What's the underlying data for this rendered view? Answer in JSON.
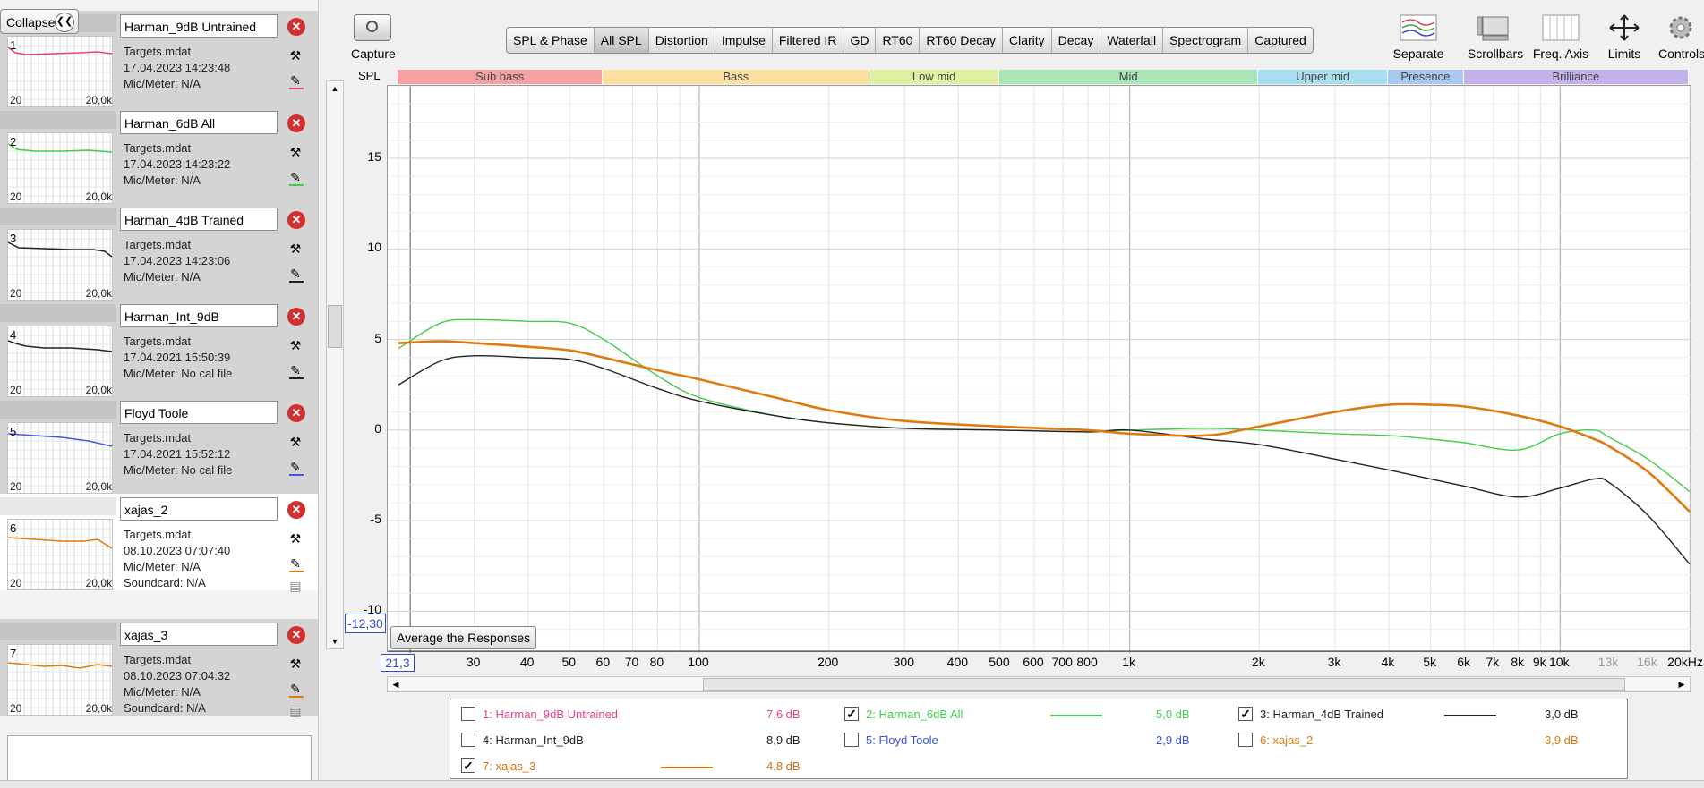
{
  "left_panel": {
    "collapse_label": "Collapse",
    "collapse_icon": "double-chevron-left-icon",
    "measurements": [
      {
        "num": "1",
        "name": "Harman_9dB Untrained",
        "file": "Targets.mdat",
        "date": "17.04.2023 14:23:48",
        "mic": "Mic/Meter: N/A",
        "soundcard": "",
        "color": "#e8418c",
        "axis_left": "20",
        "axis_right": "20,0k",
        "selected": false
      },
      {
        "num": "2",
        "name": "Harman_6dB All",
        "file": "Targets.mdat",
        "date": "17.04.2023 14:23:22",
        "mic": "Mic/Meter: N/A",
        "soundcard": "",
        "color": "#3fcf4a",
        "axis_left": "20",
        "axis_right": "20,0k",
        "selected": false
      },
      {
        "num": "3",
        "name": "Harman_4dB Trained",
        "file": "Targets.mdat",
        "date": "17.04.2023 14:23:06",
        "mic": "Mic/Meter: N/A",
        "soundcard": "",
        "color": "#222222",
        "axis_left": "20",
        "axis_right": "20,0k",
        "selected": false
      },
      {
        "num": "4",
        "name": "Harman_Int_9dB",
        "file": "Targets.mdat",
        "date": "17.04.2021 15:50:39",
        "mic": "Mic/Meter: No cal file",
        "soundcard": "",
        "color": "#222222",
        "axis_left": "20",
        "axis_right": "20,0k",
        "selected": false
      },
      {
        "num": "5",
        "name": "Floyd Toole",
        "file": "Targets.mdat",
        "date": "17.04.2021 15:52:12",
        "mic": "Mic/Meter: No cal file",
        "soundcard": "",
        "color": "#4455e0",
        "axis_left": "20",
        "axis_right": "20,0k",
        "selected": false
      },
      {
        "num": "6",
        "name": "xajas_2",
        "file": "Targets.mdat",
        "date": "08.10.2023 07:07:40",
        "mic": "Mic/Meter: N/A",
        "soundcard": "Soundcard: N/A",
        "color": "#e07a10",
        "axis_left": "20",
        "axis_right": "20,0k",
        "selected": true
      },
      {
        "num": "7",
        "name": "xajas_3",
        "file": "Targets.mdat",
        "date": "08.10.2023 07:04:32",
        "mic": "Mic/Meter: N/A",
        "soundcard": "Soundcard: N/A",
        "color": "#e07a10",
        "axis_left": "20",
        "axis_right": "20,0k",
        "selected": false
      }
    ]
  },
  "toolbar": {
    "capture_label": "Capture",
    "tabs": [
      "SPL & Phase",
      "All SPL",
      "Distortion",
      "Impulse",
      "Filtered IR",
      "GD",
      "RT60",
      "RT60 Decay",
      "Clarity",
      "Decay",
      "Waterfall",
      "Spectrogram",
      "Captured"
    ],
    "active_tab": "All SPL",
    "right_tools": [
      {
        "label": "Separate",
        "icon": "separate-traces-icon"
      },
      {
        "label": "Scrollbars",
        "icon": "scrollbars-icon"
      },
      {
        "label": "Freq. Axis",
        "icon": "freq-axis-icon"
      },
      {
        "label": "Limits",
        "icon": "limits-arrows-icon"
      },
      {
        "label": "Controls",
        "icon": "gear-icon"
      }
    ]
  },
  "plot": {
    "y_unit_label": "SPL",
    "y_cursor_value": "-12,30",
    "x_cursor_value": "21,3",
    "average_button": "Average the Responses",
    "bands": [
      {
        "label": "Sub bass",
        "color": "#f6a0a4"
      },
      {
        "label": "Bass",
        "color": "#fbe0a0"
      },
      {
        "label": "Low mid",
        "color": "#dff0a0"
      },
      {
        "label": "Mid",
        "color": "#a8e6b8"
      },
      {
        "label": "Upper mid",
        "color": "#a8dff0"
      },
      {
        "label": "Presence",
        "color": "#a8c8f4"
      },
      {
        "label": "Brilliance",
        "color": "#c4b0ec"
      }
    ]
  },
  "chart_data": {
    "type": "line",
    "title": "",
    "xlabel": "",
    "ylabel": "SPL",
    "x_scale": "log",
    "xlim": [
      20,
      20000
    ],
    "ylim": [
      -12.3,
      19
    ],
    "grid": true,
    "y_ticks": [
      15,
      10,
      5,
      0,
      -5,
      -10
    ],
    "x_ticks": [
      "30",
      "40",
      "50",
      "60",
      "70",
      "80",
      "100",
      "200",
      "300",
      "400",
      "500",
      "600",
      "700",
      "800",
      "1k",
      "2k",
      "3k",
      "4k",
      "5k",
      "6k",
      "7k",
      "8k",
      "9k",
      "10k",
      "13k",
      "16k",
      "20kHz"
    ],
    "band_edges_hz": [
      20,
      60,
      250,
      500,
      2000,
      4000,
      6000,
      20000
    ],
    "x": [
      20,
      25,
      30,
      40,
      50,
      60,
      80,
      100,
      150,
      200,
      300,
      500,
      800,
      1000,
      1500,
      2000,
      3000,
      4000,
      5000,
      6000,
      8000,
      10000,
      12000,
      13000,
      16000,
      20000
    ],
    "series": [
      {
        "name": "2: Harman_6dB All",
        "color": "#3fcf4a",
        "values": [
          4.5,
          5.9,
          6.1,
          6.0,
          5.9,
          5.0,
          3.0,
          1.8,
          0.8,
          0.4,
          0.1,
          0.0,
          -0.1,
          0.0,
          0.1,
          0.0,
          -0.2,
          -0.3,
          -0.5,
          -0.7,
          -1.1,
          -0.2,
          0.0,
          -0.4,
          -1.6,
          -3.4
        ]
      },
      {
        "name": "3: Harman_4dB Trained",
        "color": "#222222",
        "values": [
          2.5,
          3.8,
          4.1,
          4.0,
          3.9,
          3.4,
          2.3,
          1.6,
          0.8,
          0.4,
          0.1,
          0.0,
          -0.1,
          0.0,
          -0.5,
          -0.8,
          -1.6,
          -2.2,
          -2.7,
          -3.1,
          -3.7,
          -3.2,
          -2.7,
          -2.9,
          -4.7,
          -7.4
        ]
      },
      {
        "name": "7: xajas_3",
        "color": "#e07a10",
        "values": [
          4.8,
          4.9,
          4.8,
          4.6,
          4.4,
          4.0,
          3.3,
          2.8,
          1.8,
          1.1,
          0.5,
          0.2,
          0.0,
          -0.2,
          -0.3,
          0.2,
          1.0,
          1.4,
          1.4,
          1.3,
          0.8,
          0.2,
          -0.5,
          -0.9,
          -2.3,
          -4.5
        ]
      }
    ]
  },
  "legend": {
    "rows": [
      [
        {
          "label": "1: Harman_9dB Untrained",
          "value": "7,6 dB",
          "color": "#e8418c",
          "checked": false
        },
        {
          "label": "2: Harman_6dB All",
          "value": "5,0 dB",
          "color": "#3fcf4a",
          "checked": true
        },
        {
          "label": "3: Harman_4dB Trained",
          "value": "3,0 dB",
          "color": "#222222",
          "checked": true
        }
      ],
      [
        {
          "label": "4: Harman_Int_9dB",
          "value": "8,9 dB",
          "color": "#222222",
          "checked": false
        },
        {
          "label": "5: Floyd Toole",
          "value": "2,9 dB",
          "color": "#3b4fe0",
          "checked": false
        },
        {
          "label": "6: xajas_2",
          "value": "3,9 dB",
          "color": "#e07a10",
          "checked": false
        }
      ],
      [
        {
          "label": "7: xajas_3",
          "value": "4,8 dB",
          "color": "#d4700e",
          "checked": true
        }
      ]
    ]
  }
}
